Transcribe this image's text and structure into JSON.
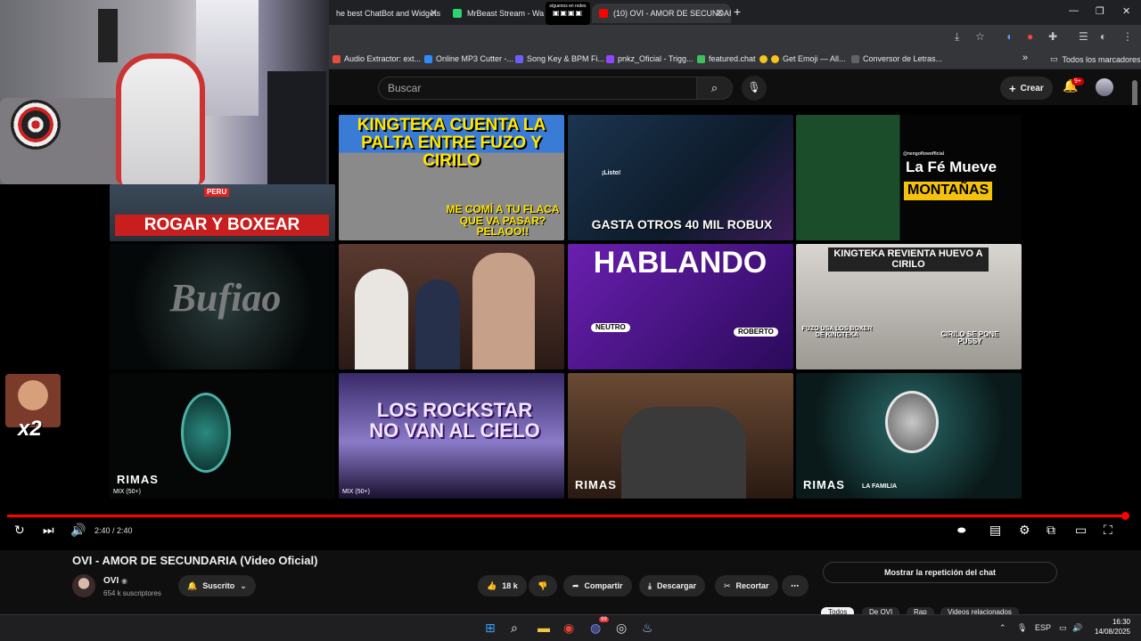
{
  "browser": {
    "tabs": [
      {
        "label": "he best ChatBot and Widgets",
        "active": false
      },
      {
        "label": "MrBeast Stream - Wa",
        "active": false
      },
      {
        "label": "(10) OVI - AMOR DE SECUNDAR",
        "active": true
      }
    ],
    "tab_overlay": "síguenos en redes",
    "bookmarks": [
      "Audio Extractor: ext...",
      "Online MP3 Cutter -...",
      "Song Key & BPM Fi...",
      "pnkz_Oficial - Trigg...",
      "featured.chat",
      "Get Emoji — All...",
      "Conversor de Letras..."
    ],
    "bookmarks_more": "»",
    "bookmarks_folder": "Todos los marcadores"
  },
  "youtube_header": {
    "search_placeholder": "Buscar",
    "create_label": "Crear",
    "notifications_badge": "9+"
  },
  "endscreen": {
    "thumbnails": [
      {
        "title": "ROGAR Y BOXEAR",
        "tag": "PERU"
      },
      {
        "title": "KINGTEKA CUENTA LA PALTA ENTRE FUZO Y CIRILO",
        "sub": "ME COMÍ A TU FLACA QUE VA PASAR? PELAOO!!"
      },
      {
        "title": "GASTA OTROS 40 MIL ROBUX",
        "overlay": "¡Listo!"
      },
      {
        "title": "La Fé Mueve",
        "title2": "MONTAÑAS",
        "handle": "@nengoflowofficial"
      },
      {
        "title": "Bufiao"
      },
      {
        "title": ""
      },
      {
        "title": "HABLANDO",
        "left": "NEUTRO",
        "right": "ROBERTO"
      },
      {
        "title": "KINGTEKA REVIENTA HUEVO A CIRILO",
        "left": "FUZO USA LOS BOXER DE KINGTEKA",
        "right": "CIRILO SE PONE PUSSY"
      },
      {
        "brand": "RIMAS",
        "mix": "MIX (50+)"
      },
      {
        "title": "LOS ROCKSTAR NO VAN AL CIELO",
        "mix": "MIX (50+)"
      },
      {
        "brand": "RIMAS"
      },
      {
        "brand": "RIMAS",
        "brand2": "LA FAMILIA"
      }
    ]
  },
  "player": {
    "time": "2:40 / 2:40",
    "progress": 1.0
  },
  "video": {
    "title": "OVI - AMOR DE SECUNDARIA (Video Oficial)",
    "channel": "OVI",
    "subscribers": "654 k suscriptores",
    "subscribe_label": "Suscrito",
    "likes": "18 k",
    "share_label": "Compartir",
    "download_label": "Descargar",
    "clip_label": "Recortar",
    "chat_replay_label": "Mostrar la repetición del chat",
    "chips": [
      "Todos",
      "De OVI",
      "Rap",
      "Videos relacionados"
    ]
  },
  "emote": {
    "label": "x2"
  },
  "taskbar": {
    "language": "ESP",
    "time": "16:30",
    "date": "14/08/2025",
    "discord_badge": "99"
  }
}
